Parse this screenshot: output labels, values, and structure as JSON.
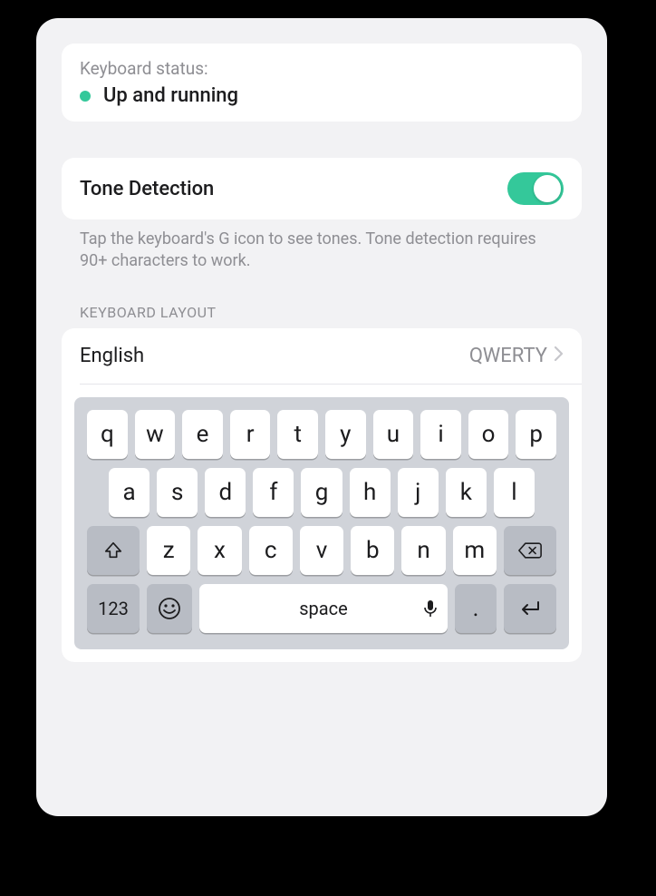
{
  "status": {
    "label": "Keyboard status:",
    "text": "Up and running",
    "dotColor": "#34c89a"
  },
  "toneDetection": {
    "title": "Tone Detection",
    "enabled": true,
    "caption": "Tap the keyboard's G icon to see tones. Tone detection requires 90+ characters to work."
  },
  "layout": {
    "header": "KEYBOARD LAYOUT",
    "language": "English",
    "value": "QWERTY"
  },
  "keyboard": {
    "row1": [
      "q",
      "w",
      "e",
      "r",
      "t",
      "y",
      "u",
      "i",
      "o",
      "p"
    ],
    "row2": [
      "a",
      "s",
      "d",
      "f",
      "g",
      "h",
      "j",
      "k",
      "l"
    ],
    "row3": [
      "z",
      "x",
      "c",
      "v",
      "b",
      "n",
      "m"
    ],
    "numbers": "123",
    "space": "space",
    "period": "."
  }
}
